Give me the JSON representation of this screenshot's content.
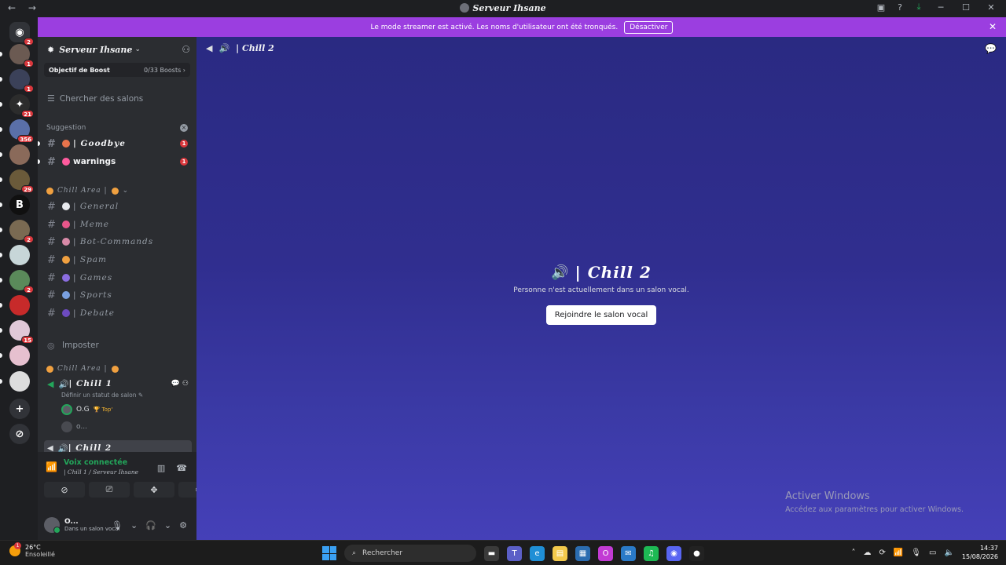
{
  "window": {
    "title": "Serveur Ihsane",
    "nav": "← →",
    "controls": {
      "minimize": "─",
      "maximize": "☐",
      "close": "✕"
    }
  },
  "banner": {
    "text": "Le mode streamer est activé. Les noms d'utilisateur ont été tronqués.",
    "button": "Désactiver",
    "close": "✕"
  },
  "servers": [
    {
      "name": "direct-messages",
      "badge": "2",
      "color": "#313338",
      "glyph": "◉"
    },
    {
      "name": "server-1",
      "badge": "1",
      "color": "#6b5a52"
    },
    {
      "name": "server-2",
      "badge": "1",
      "color": "#3b4159"
    },
    {
      "name": "server-3",
      "badge": "21",
      "color": "#2c2c2c",
      "glyph": "✦"
    },
    {
      "name": "server-4",
      "badge": "356",
      "color": "#5a6fa8"
    },
    {
      "name": "server-5",
      "badge": "",
      "color": "#8a6a5a"
    },
    {
      "name": "server-6",
      "badge": "29",
      "color": "#6a5a3a"
    },
    {
      "name": "server-7",
      "badge": "",
      "color": "#101010",
      "glyph": "B"
    },
    {
      "name": "server-8",
      "badge": "2",
      "color": "#7a6a52"
    },
    {
      "name": "server-9",
      "badge": "",
      "color": "#c7d6d8"
    },
    {
      "name": "server-10",
      "badge": "2",
      "color": "#5a8a5a"
    },
    {
      "name": "server-11",
      "badge": "",
      "color": "#c72a2a"
    },
    {
      "name": "server-12",
      "badge": "15",
      "color": "#e0c8d8"
    },
    {
      "name": "server-13",
      "badge": "",
      "color": "#e6c0cf"
    },
    {
      "name": "server-14",
      "badge": "",
      "color": "#dddddd"
    },
    {
      "name": "add-server",
      "badge": "",
      "color": "#313338",
      "glyph": "+"
    },
    {
      "name": "explore",
      "badge": "",
      "color": "#313338",
      "glyph": "⊘"
    }
  ],
  "sidebar": {
    "server_name": "Serveur Ihsane",
    "boost_label": "Objectif de Boost",
    "boost_count": "0/33 Boosts ›",
    "search": "Chercher des salons",
    "category_suggestion": "Suggestion",
    "channels_top": [
      {
        "label": "| Goodbye",
        "emoji": "#e8744c",
        "unread": "1",
        "fancy": true
      },
      {
        "label": "warnings",
        "emoji": "#ff5b9e",
        "unread": "1",
        "fancy": false
      }
    ],
    "category_chill": "Chill Area |",
    "channels_chill": [
      {
        "label": "| General",
        "emoji": "#e8eaee"
      },
      {
        "label": "| Meme",
        "emoji": "#e8568a"
      },
      {
        "label": "| Bot-Commands",
        "emoji": "#d88aa8"
      },
      {
        "label": "| Spam",
        "emoji": "#f0a040"
      },
      {
        "label": "| Games",
        "emoji": "#8b6de0"
      },
      {
        "label": "| Sports",
        "emoji": "#7aa0e0"
      },
      {
        "label": "| Debate",
        "emoji": "#6d4bc0"
      }
    ],
    "imposter": "Imposter",
    "category_chill2": "Chill Area |",
    "voice_chill1": "| Chill 1",
    "status_line": "Définir un statut de salon ✎",
    "members": [
      {
        "name": "O.G",
        "tag": "🏆 Top'"
      },
      {
        "name": "o...",
        "tag": ""
      }
    ],
    "voice_chill2": "| Chill 2"
  },
  "voice_panel": {
    "status": "Voix connectée",
    "channel": "| Chill 1 / Serveur Ihsane",
    "user_name": "O...",
    "user_status": "Dans un salon vocal"
  },
  "main": {
    "header_title": "| Chill 2",
    "vc_title": "| Chill 2",
    "desc": "Personne n'est actuellement dans un salon vocal.",
    "join_button": "Rejoindre le salon vocal"
  },
  "watermark": {
    "line1": "Activer Windows",
    "line2": "Accédez aux paramètres pour activer Windows."
  },
  "taskbar": {
    "temp": "26°C",
    "condition": "Ensoleillé",
    "search": "Rechercher",
    "time": "14:37",
    "date": "15/08/2026",
    "apps": [
      {
        "name": "file-explorer-dark",
        "color": "#3a3a3a",
        "glyph": "▬"
      },
      {
        "name": "teams",
        "color": "#5b5fc7",
        "glyph": "T"
      },
      {
        "name": "edge",
        "color": "#1f8fd6",
        "glyph": "e"
      },
      {
        "name": "folders",
        "color": "#f2c94c",
        "glyph": "▤"
      },
      {
        "name": "store",
        "color": "#2b6cb0",
        "glyph": "▦"
      },
      {
        "name": "opera",
        "color": "#c23bd4",
        "glyph": "O"
      },
      {
        "name": "outlook",
        "color": "#2a7ac8",
        "glyph": "✉"
      },
      {
        "name": "spotify",
        "color": "#1db954",
        "glyph": "♫"
      },
      {
        "name": "discord",
        "color": "#5865f2",
        "glyph": "◉"
      },
      {
        "name": "obs",
        "color": "#222222",
        "glyph": "●"
      }
    ]
  }
}
